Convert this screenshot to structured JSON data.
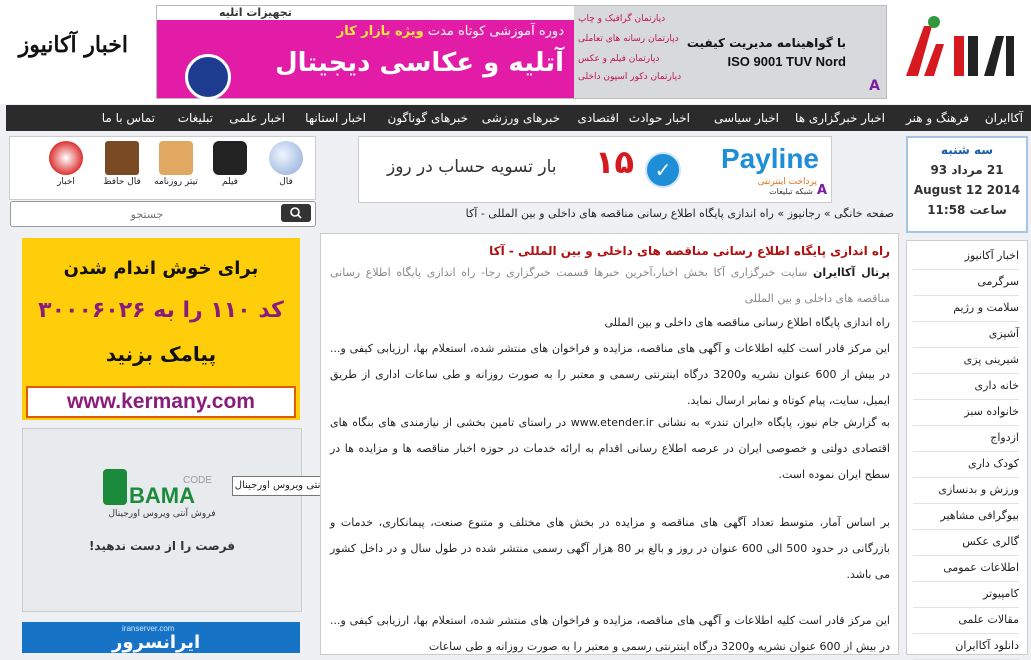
{
  "header": {
    "site_title_left": "اخبار آکانیوز",
    "logo_right": "آکا ایران",
    "banner": {
      "top_label": "تجهیزات اتلیه",
      "headline_small": "دوره آموزشی کوتاه مدت",
      "highlight": "ویژه بازار کار",
      "headline_big": "آتلیه و عکاسی دیجیتال",
      "dept_1": "دپارتمان گرافیک و چاپ",
      "dept_2": "دپارتمان رسانه های تعاملی",
      "dept_3": "دپارتمان فیلم و عکس",
      "dept_4": "دپارتمان دکور اسپون داخلی",
      "iso_line1": "با گواهینامه مدیریت کیفیت",
      "iso_line2": "ISO 9001 TUV Nord",
      "badge": "A"
    }
  },
  "nav": [
    "آکاایران",
    "فرهنگ و هنر",
    "اخبار خبرگزاری ها",
    "اخبار سیاسی",
    "اخبار حوادث",
    "اقتصادی",
    "خبرهای ورزشی",
    "خبرهای گوناگون",
    "اخبار استانها",
    "اخبار علمی",
    "تبلیغات",
    "تماس با ما"
  ],
  "iconbar": [
    "فال",
    "فیلم",
    "تیتر روزنامه",
    "فال حافظ",
    "اخبار"
  ],
  "search": {
    "placeholder": "جستجو"
  },
  "ads": {
    "yellow_line1": "برای خوش اندام شدن",
    "yellow_line2": "کد ۱۱۰ را به ۳۰۰۰۶۰۲۶",
    "yellow_line3": "پیامک بزنید",
    "yellow_url": "www.kermany.com",
    "bama_code": "CODE",
    "bama_brand": "BAMA",
    "bama_sub": "فروش آنتی ویروس اورجینال",
    "bama_cta": "فرصت را از دست ندهید!",
    "tooltip": "آنتی ویروس اورجینال",
    "bottom_brand": "ایرانسرور",
    "bottom_url": "iranserver.com",
    "payline_brand": "Payline",
    "payline_sub": "پرداخت اینترنتی",
    "payline_text": "بار تسویه حساب در روز",
    "payline_num": "۱۵",
    "payline_network": "شبکه تبلیغات",
    "payline_badge": "A"
  },
  "breadcrumb": {
    "home": "صفحه خانگی",
    "sep": "»",
    "cat": "رجانیوز",
    "current": "راه اندازی پایگاه اطلاع رسانی مناقصه های داخلی و بین المللی - آکا"
  },
  "article": {
    "title": "راه اندازی پایگاه اطلاع رسانی مناقصه های داخلی و بین المللی - آکا",
    "portal_label": "پرتال آکاایران",
    "lead": "سایت خبرگزاری آکا بخش اخبار،آخرین خبرها قسمت خبرگزاری رجا- راه اندازی پایگاه اطلاع رسانی مناقصه های داخلی و بین المللی",
    "p1": "راه اندازی پایگاه اطلاع رسانی مناقصه های داخلی و بین المللی",
    "p2": "این مرکز قادر است کلیه اطلاعات و آگهی های مناقصه، مزایده و فراخوان های منتشر شده، استعلام بها، ارزیابی کیفی و... در بیش از 600 عنوان نشریه و3200 درگاه اینترنتی رسمی و معتبر را به صورت روزانه و طی ساعات اداری از طریق ایمیل، سایت، پیام کوتاه و نمابر ارسال نماید.",
    "p3": "به گزارش جام نیوز، پایگاه «ایران تندر» به نشانی www.etender.ir در راستای تامین بخشی از نیازمندی های بنگاه های اقتصادی دولتی و خصوصی ایران در عرصه اطلاع رسانی اقدام به ارائه خدمات در حوزه اخبار مناقصه ها و مزایده ها در سطح ایران نموده است.",
    "p4": "بر اساس آمار، متوسط تعداد آگهی های مناقصه و مزایده در بخش های مختلف و متنوع صنعت، پیمانکاری، خدمات و بازرگانی در حدود 500 الی 600 عنوان در روز و بالغ بر 80 هزار آگهی رسمی منتشر شده در طول سال و در داخل کشور می باشد.",
    "p5": "این مرکز قادر است کلیه اطلاعات و آگهی های مناقصه، مزایده و فراخوان های منتشر شده، استعلام بها، ارزیابی کیفی و... در بیش از 600 عنوان نشریه و3200 درگاه اینترنتی رسمی و معتبر را به صورت روزانه و طی ساعات"
  },
  "date": {
    "weekday": "سه شنبه",
    "persian": "21 مرداد 93",
    "gregorian": "2014 August 12",
    "time": "ساعت 11:58"
  },
  "categories": [
    "اخبار آکانیوز",
    "سرگرمی",
    "سلامت و رژیم",
    "آشپزی",
    "شیرینی پزی",
    "خانه داری",
    "خانواده سبز",
    "ازدواج",
    "کودک داری",
    "ورزش و بدنسازی",
    "بیوگرافی مشاهیر",
    "گالری عکس",
    "اطلاعات عمومی",
    "کامپیوتر",
    "مقالات علمی",
    "دانلود آکاایران"
  ],
  "colors": {
    "accent": "#b01010",
    "nav_bg": "#2b2b2b",
    "ad_yellow": "#ffce0a",
    "banner_pink": "#e21ca6"
  }
}
